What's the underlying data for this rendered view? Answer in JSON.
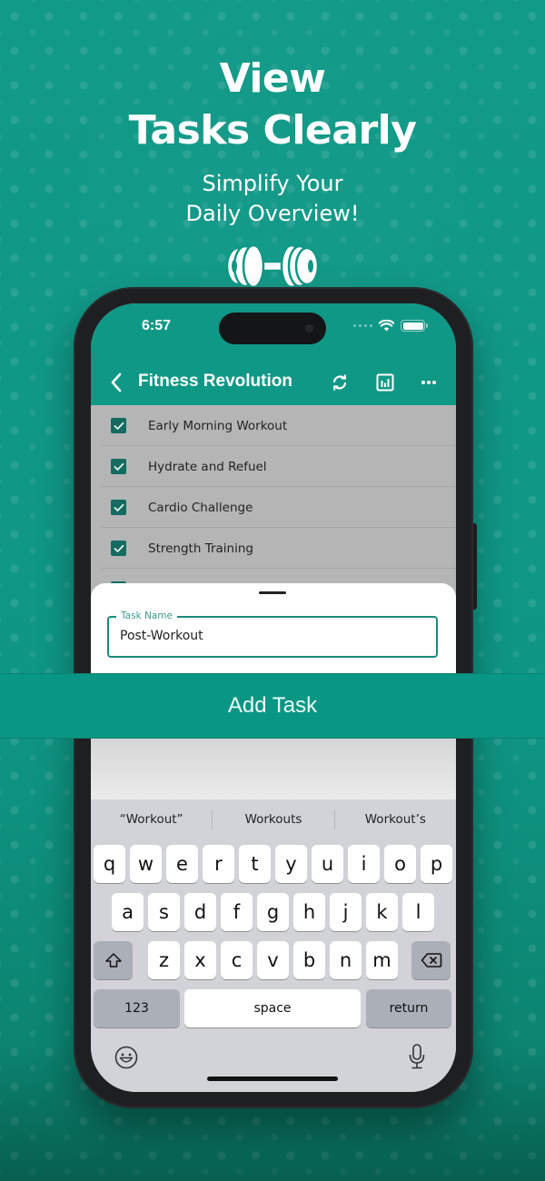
{
  "promo": {
    "title_line1": "View",
    "title_line2": "Tasks Clearly",
    "subtitle_line1": "Simplify Your",
    "subtitle_line2": "Daily Overview!",
    "logo_icon": "dumbbell-icon"
  },
  "status_bar": {
    "time": "6:57",
    "icons": [
      "signal-icon",
      "wifi-icon",
      "battery-icon"
    ]
  },
  "app_bar": {
    "back_icon": "chevron-left-icon",
    "title": "Fitness Revolution",
    "actions": [
      "refresh-icon",
      "chart-icon",
      "more-icon"
    ]
  },
  "tasks": [
    {
      "label": "Early Morning Workout",
      "checked": true
    },
    {
      "label": "Hydrate and Refuel",
      "checked": true
    },
    {
      "label": "Cardio Challenge",
      "checked": true
    },
    {
      "label": "Strength Training",
      "checked": true
    }
  ],
  "sheet": {
    "field_label": "Task Name",
    "field_value": "Post-Workout"
  },
  "add_button": {
    "label": "Add Task"
  },
  "keyboard": {
    "suggestions": [
      "“Workout”",
      "Workouts",
      "Workout’s"
    ],
    "row1": [
      "q",
      "w",
      "e",
      "r",
      "t",
      "y",
      "u",
      "i",
      "o",
      "p"
    ],
    "row2": [
      "a",
      "s",
      "d",
      "f",
      "g",
      "h",
      "j",
      "k",
      "l"
    ],
    "row3": [
      "z",
      "x",
      "c",
      "v",
      "b",
      "n",
      "m"
    ],
    "numbers_label": "123",
    "space_label": "space",
    "return_label": "return"
  },
  "colors": {
    "brand_teal": "#109886",
    "checkbox": "#136b61",
    "field_border": "#1a8b7b"
  }
}
